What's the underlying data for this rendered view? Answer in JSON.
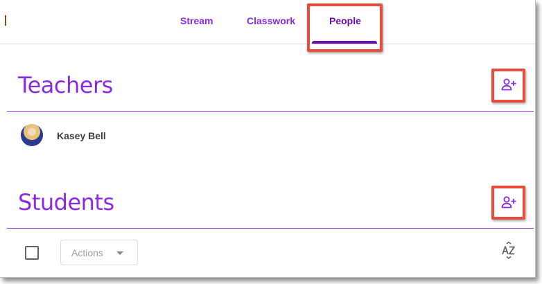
{
  "tabs": {
    "stream": "Stream",
    "classwork": "Classwork",
    "people": "People",
    "active": "people"
  },
  "teachers": {
    "title": "Teachers",
    "add_icon": "person-add-icon",
    "members": [
      {
        "name": "Kasey Bell",
        "avatar": "avatar"
      }
    ]
  },
  "students": {
    "title": "Students",
    "add_icon": "person-add-icon",
    "actions_label": "Actions",
    "sort_icon": "sort-az-icon"
  },
  "colors": {
    "accent": "#8a2be2",
    "accent_dark": "#6a0dad",
    "highlight": "#e74c3c"
  }
}
